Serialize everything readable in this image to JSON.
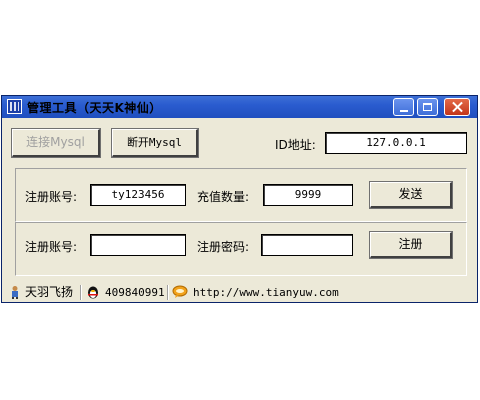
{
  "window": {
    "title": "管理工具（天天K神仙）"
  },
  "toolbar": {
    "connect_label": "连接Mysql",
    "disconnect_label": "断开Mysql",
    "ip_label": "ID地址:",
    "ip_value": "127.0.0.1"
  },
  "recharge": {
    "account_label": "注册账号:",
    "account_value": "ty123456",
    "amount_label": "充值数量:",
    "amount_value": "9999",
    "send_label": "发送"
  },
  "register": {
    "account_label": "注册账号:",
    "account_value": "",
    "password_label": "注册密码:",
    "password_value": "",
    "register_label": "注册"
  },
  "statusbar": {
    "user": "天羽飞扬",
    "qq": "409840991",
    "website": "http://www.tianyuw.com"
  },
  "colors": {
    "titlebar": "#2a5ccf",
    "window_bg": "#ece9d8",
    "close_button": "#c2351a"
  }
}
